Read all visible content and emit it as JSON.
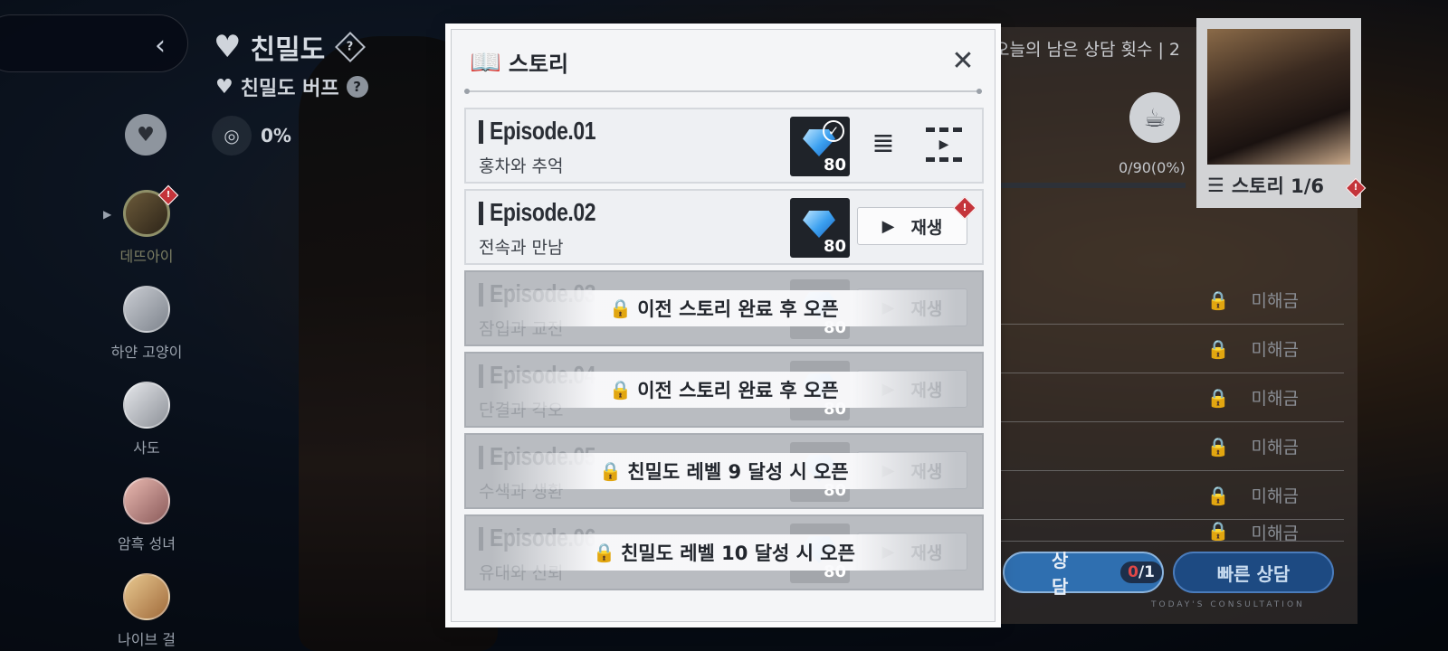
{
  "left_panel": {
    "title": "친밀도",
    "buff_label": "친밀도 버프",
    "buff_value": "0%",
    "characters": [
      {
        "name": "데뜨아이",
        "active": true
      },
      {
        "name": "하얀 고양이",
        "active": false
      },
      {
        "name": "사도",
        "active": false
      },
      {
        "name": "암흑 성녀",
        "active": false
      },
      {
        "name": "나이브 걸",
        "active": false
      }
    ]
  },
  "right_panel": {
    "consult_count_label": "오늘의 남은 상담 횟수 | 2",
    "exp_text": "0/90(0%)",
    "exp_progress": 0,
    "story_label": "스토리 1/6",
    "locked_label": "미해금",
    "locked_rows": 6,
    "consult_button": "상담",
    "consult_used": "0",
    "consult_total": "/1",
    "fast_consult_button": "빠른 상담",
    "today_label": "TODAY'S CONSULTATION"
  },
  "dialog": {
    "title": "스토리",
    "episodes": [
      {
        "name": "Episode.01",
        "subtitle": "홍차와 추억",
        "reward": "80",
        "completed": true,
        "locked": false
      },
      {
        "name": "Episode.02",
        "subtitle": "전속과 만남",
        "reward": "80",
        "completed": false,
        "locked": false,
        "play_label": "재생"
      },
      {
        "name": "Episode.03",
        "subtitle": "잠입과 교전",
        "reward": "80",
        "locked": true,
        "lock_text": "이전 스토리 완료 후 오픈",
        "play_label": "재생"
      },
      {
        "name": "Episode.04",
        "subtitle": "단결과 각오",
        "reward": "80",
        "locked": true,
        "lock_text": "이전 스토리 완료 후 오픈",
        "play_label": "재생"
      },
      {
        "name": "Episode.05",
        "subtitle": "수색과 생환",
        "reward": "80",
        "locked": true,
        "lock_text": "친밀도 레벨 9 달성 시 오픈",
        "play_label": "재생"
      },
      {
        "name": "Episode.06",
        "subtitle": "유대와 신뢰",
        "reward": "80",
        "locked": true,
        "lock_text": "친밀도 레벨 10 달성 시 오픈",
        "play_label": "재생"
      }
    ]
  },
  "colors": {
    "accent_blue": "#2f6fb0",
    "alert_red": "#c4343a",
    "dialog_bg": "#f4f5f7"
  }
}
